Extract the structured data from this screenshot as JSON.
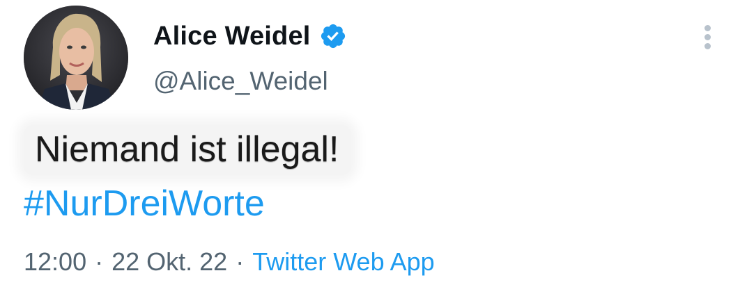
{
  "tweet": {
    "author": {
      "display_name": "Alice Weidel",
      "handle": "@Alice_Weidel",
      "verified": true,
      "verified_icon": "verified-badge-icon",
      "avatar": "profile-photo"
    },
    "text": "Niemand ist illegal!",
    "hashtag": "#NurDreiWorte",
    "meta": {
      "time": "12:00",
      "separator": "·",
      "date": "22 Okt. 22",
      "source": "Twitter Web App"
    },
    "more_icon": "more-options-icon"
  },
  "colors": {
    "link": "#1d9bf0",
    "secondary_text": "#536471",
    "primary_text": "#0f1419"
  }
}
